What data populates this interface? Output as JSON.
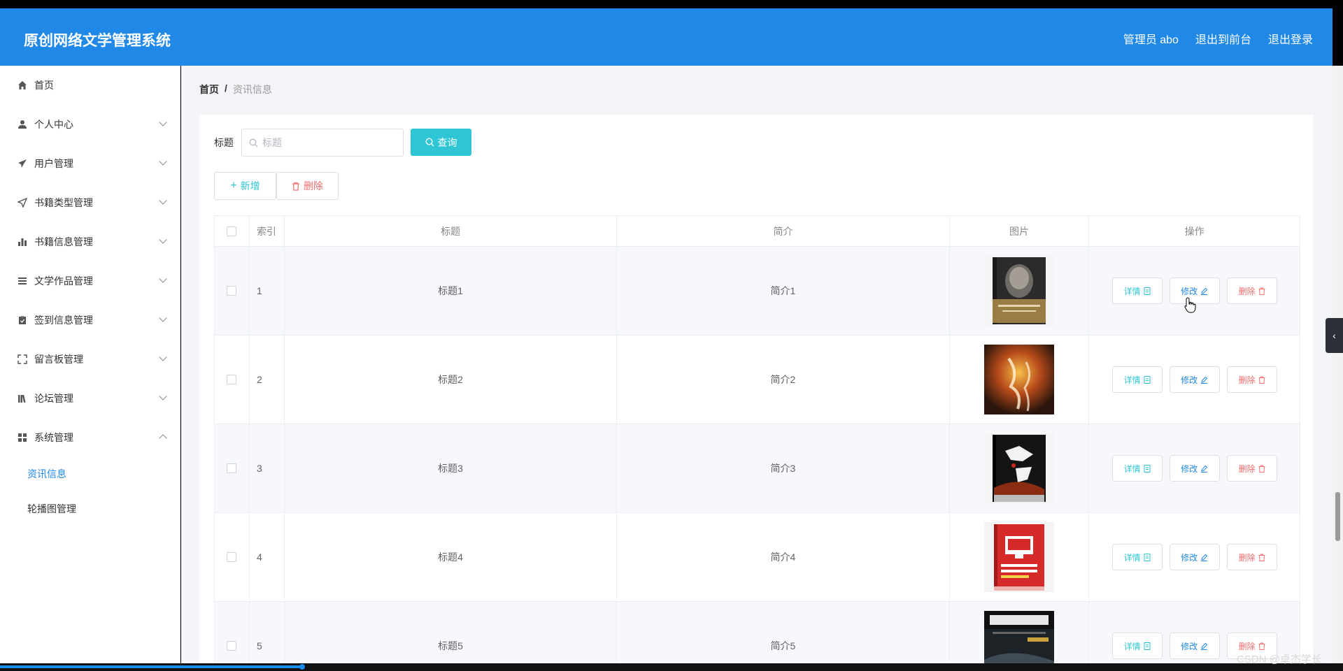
{
  "header": {
    "brand": "原创网络文学管理系统",
    "admin": "管理员 abo",
    "to_front": "退出到前台",
    "logout": "退出登录"
  },
  "sidebar": {
    "items": [
      {
        "label": "首页",
        "icon": "home-icon"
      },
      {
        "label": "个人中心",
        "icon": "user-icon"
      },
      {
        "label": "用户管理",
        "icon": "send-icon"
      },
      {
        "label": "书籍类型管理",
        "icon": "navigation-icon"
      },
      {
        "label": "书籍信息管理",
        "icon": "bar-chart-icon"
      },
      {
        "label": "文学作品管理",
        "icon": "list-icon"
      },
      {
        "label": "签到信息管理",
        "icon": "clipboard-icon"
      },
      {
        "label": "留言板管理",
        "icon": "fullscreen-icon"
      },
      {
        "label": "论坛管理",
        "icon": "library-icon"
      },
      {
        "label": "系统管理",
        "icon": "grid-icon"
      }
    ],
    "sub_items": [
      {
        "label": "资讯信息",
        "active": true
      },
      {
        "label": "轮播图管理",
        "active": false
      }
    ]
  },
  "breadcrumb": {
    "home": "首页",
    "sep": "/",
    "current": "资讯信息"
  },
  "search": {
    "label": "标题",
    "placeholder": "标题",
    "button": "查询"
  },
  "actions": {
    "add": "新增",
    "delete": "删除"
  },
  "table": {
    "headers": {
      "index": "索引",
      "title": "标题",
      "intro": "简介",
      "image": "图片",
      "ops": "操作"
    },
    "rows": [
      {
        "index": "1",
        "title": "标题1",
        "intro": "简介1"
      },
      {
        "index": "2",
        "title": "标题2",
        "intro": "简介2"
      },
      {
        "index": "3",
        "title": "标题3",
        "intro": "简介3"
      },
      {
        "index": "4",
        "title": "标题4",
        "intro": "简介4"
      },
      {
        "index": "5",
        "title": "标题5",
        "intro": "简介5"
      }
    ],
    "ops": {
      "detail": "详情",
      "edit": "修改",
      "remove": "删除"
    }
  },
  "watermark": "CSDN @卓杰学长",
  "colors": {
    "primary": "#2088e6",
    "cyan": "#2ec6d5",
    "danger": "#f56c6c"
  }
}
